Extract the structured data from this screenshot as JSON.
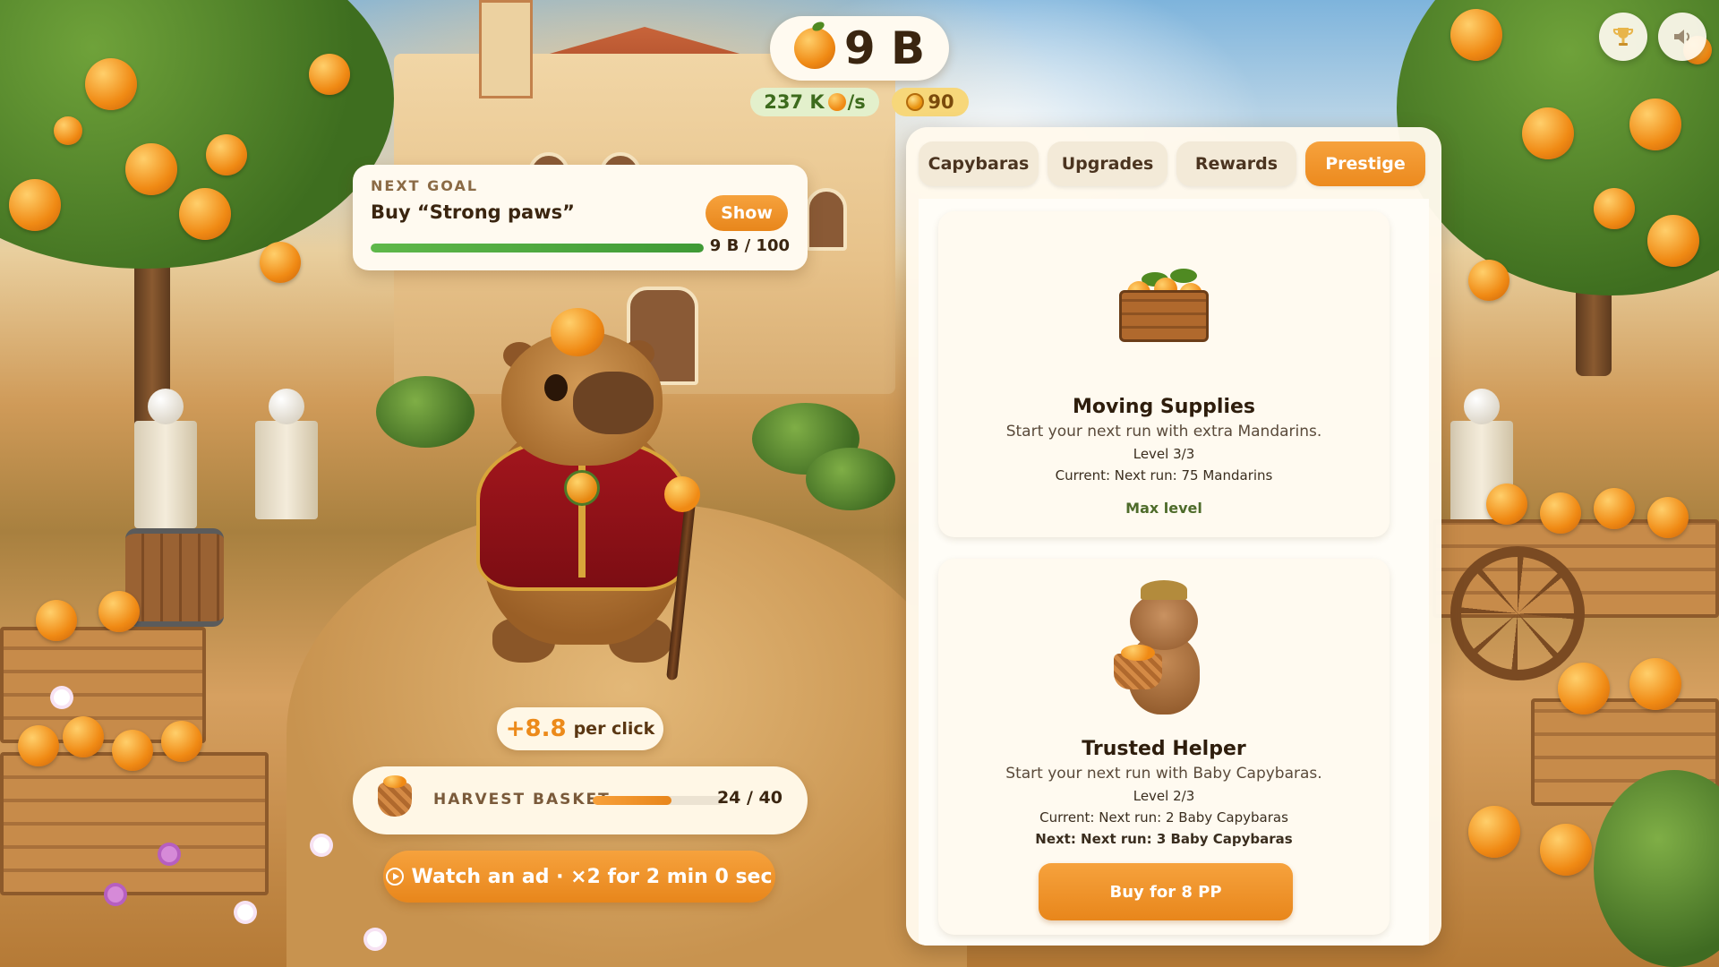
{
  "hud": {
    "total": "9 B",
    "rate": "237 K",
    "rate_unit": "/s",
    "gold": "90",
    "trophy_icon": "trophy-icon",
    "sound_icon": "speaker-icon"
  },
  "next_goal": {
    "kicker": "NEXT GOAL",
    "title": "Buy “Strong paws”",
    "button": "Show",
    "progress_text": "9 B / 100",
    "progress_fraction": 1.0
  },
  "per_click": {
    "value": "+8.8",
    "label": "per click"
  },
  "harvest_basket": {
    "label": "HARVEST BASKET",
    "count": "24 / 40",
    "fraction": 0.6
  },
  "ad_button": {
    "label": "Watch an ad · ×2 for 2 min 0 sec"
  },
  "tabs": [
    {
      "label": "Capybaras",
      "active": false
    },
    {
      "label": "Upgrades",
      "active": false
    },
    {
      "label": "Rewards",
      "active": false
    },
    {
      "label": "Prestige",
      "active": true
    }
  ],
  "cards": [
    {
      "title": "Moving Supplies",
      "description": "Start your next run with extra Mandarins.",
      "level": "Level 3/3",
      "current": "Current: Next run: 75 Mandarins",
      "status": "Max level"
    },
    {
      "title": "Trusted Helper",
      "description": "Start your next run with Baby Capybaras.",
      "level": "Level 2/3",
      "current": "Current: Next run: 2 Baby Capybaras",
      "next": "Next: Next run: 3 Baby Capybaras",
      "button": "Buy for 8 PP"
    }
  ],
  "colors": {
    "accent": "#ec8a1a",
    "goal_bar": "#4faa3f",
    "panel_bg": "#fff9ec"
  }
}
